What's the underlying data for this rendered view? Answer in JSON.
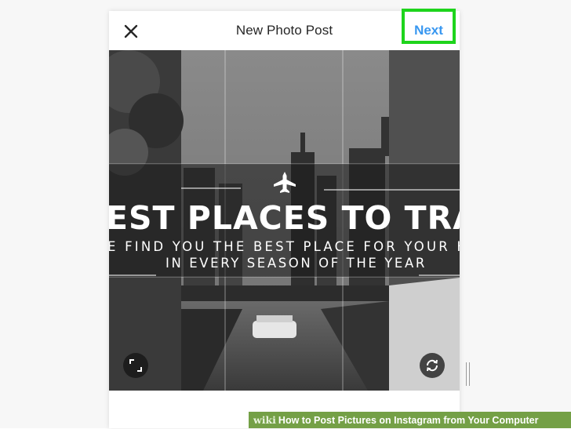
{
  "dialog": {
    "title": "New Photo Post",
    "next_label": "Next",
    "close_icon": "close-icon"
  },
  "photo": {
    "headline": "EST PLACES TO TRAVE",
    "subline_1": "E FIND YOU THE BEST PLACE FOR YOUR HOLI",
    "subline_2": "IN EVERY SEASON OF THE YEAR",
    "plane_icon": "airplane-icon"
  },
  "tools": {
    "expand_icon": "expand-icon",
    "rotate_icon": "rotate-icon"
  },
  "footer": {
    "brand": "wiki",
    "how": "How",
    "rest": " to Post Pictures on Instagram from Your Computer"
  },
  "colors": {
    "next_blue": "#3897f0",
    "highlight_green": "#1ed41c",
    "footer_green": "#74a046"
  }
}
